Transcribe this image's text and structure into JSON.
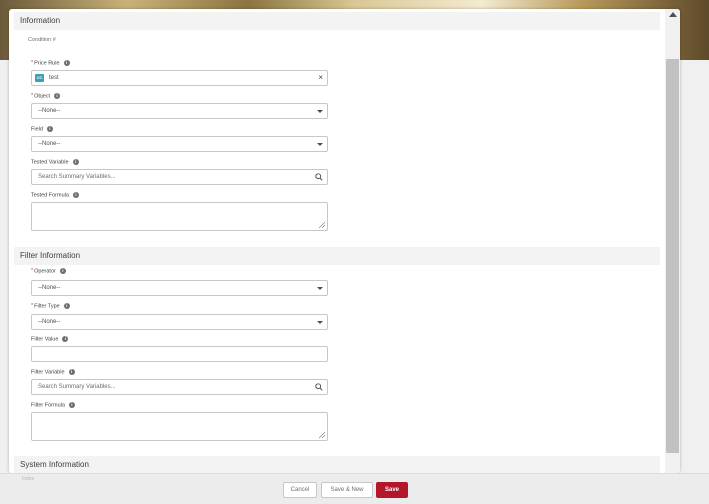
{
  "modal": {
    "sections": {
      "information": "Information",
      "filter_information": "Filter Information",
      "system_information": "System Information"
    },
    "condition_label": "Condition #",
    "fields": {
      "price_rule": {
        "label": "Price Rule",
        "required": "*",
        "value": "test",
        "tag": "CC"
      },
      "object": {
        "label": "Object",
        "required": "*",
        "value": "--None--"
      },
      "field": {
        "label": "Field",
        "value": "--None--"
      },
      "tested_variable": {
        "label": "Tested Variable",
        "placeholder": "Search Summary Variables..."
      },
      "tested_formula": {
        "label": "Tested Formula"
      },
      "operator": {
        "label": "Operator",
        "required": "*",
        "value": "--None--"
      },
      "filter_type": {
        "label": "Filter Type",
        "required": "*",
        "value": "--None--"
      },
      "filter_value": {
        "label": "Filter Value"
      },
      "filter_variable": {
        "label": "Filter Variable",
        "placeholder": "Search Summary Variables..."
      },
      "filter_formula": {
        "label": "Filter Formula"
      }
    },
    "info_glyph": "i",
    "clear_glyph": "×",
    "faded_label": "Index"
  },
  "footer": {
    "cancel_label": "Cancel",
    "save_new_label": "Save & New",
    "save_label": "Save"
  },
  "colors": {
    "accent_save": "#b3172c",
    "required": "#c23934",
    "lookup_icon": "#3ba0b0"
  },
  "icons": [
    "info-icon",
    "search-icon",
    "chevron-down-icon",
    "clear-icon",
    "resize-grip-icon",
    "scroll-up-arrow-icon"
  ]
}
